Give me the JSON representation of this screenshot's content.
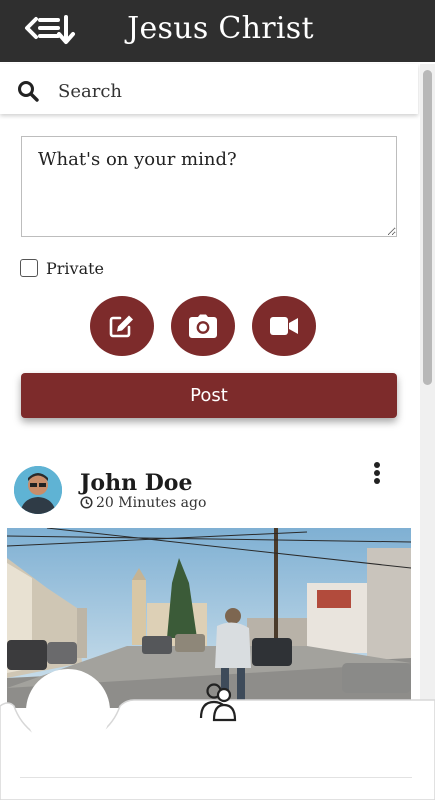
{
  "header": {
    "title": "Jesus Christ",
    "back_icon": "back-list-icon"
  },
  "search": {
    "placeholder": "Search",
    "icon": "search-icon"
  },
  "composer": {
    "placeholder": "What's on your mind?",
    "private_label": "Private",
    "private_checked": false,
    "actions": [
      "edit-icon",
      "camera-icon",
      "video-icon"
    ],
    "post_label": "Post"
  },
  "post": {
    "author": "John Doe",
    "time": "20 Minutes ago",
    "more_icon": "more-vertical-icon"
  },
  "bottom_nav": {
    "icons": [
      "people-icon"
    ]
  },
  "colors": {
    "header_bg": "#2f2f2f",
    "accent": "#7d2b2b"
  }
}
